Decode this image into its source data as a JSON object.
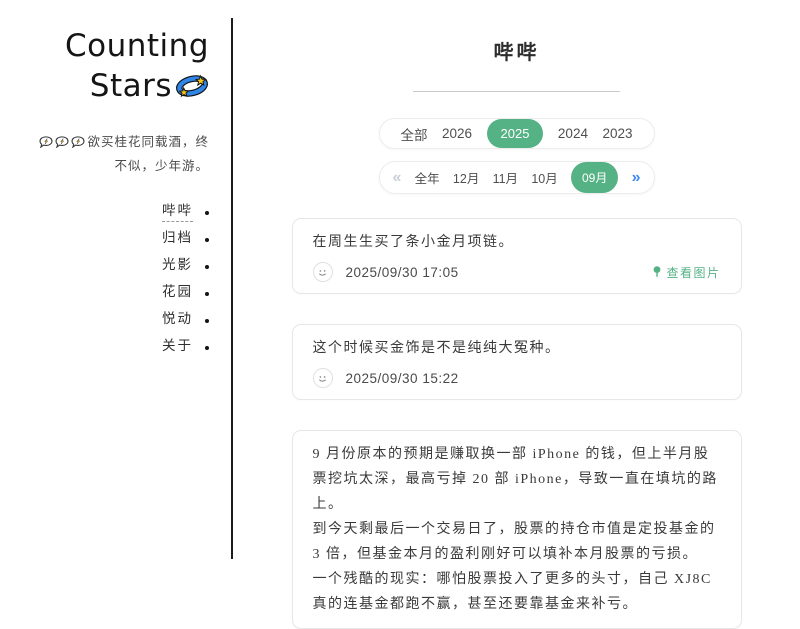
{
  "colors": {
    "accent_green": "#55b285",
    "next_arrow_blue": "#3d8af2",
    "prev_arrow_gray": "#c9ced6"
  },
  "icons": {
    "dizzy_star": "💫",
    "speech_bubble_lightning": "🗯",
    "smiley": "☺",
    "image_pin": "●",
    "prev_chevrons": "«",
    "next_chevrons": "»"
  },
  "sidebar": {
    "title_line1": "Counting",
    "title_line2": "Stars",
    "quote_line1": "欲买桂花同载酒，终",
    "quote_line2": "不似，少年游。",
    "nav": [
      {
        "label": "哔哔",
        "active": true
      },
      {
        "label": "归档",
        "active": false
      },
      {
        "label": "光影",
        "active": false
      },
      {
        "label": "花园",
        "active": false
      },
      {
        "label": "悦动",
        "active": false
      },
      {
        "label": "关于",
        "active": false
      }
    ]
  },
  "main": {
    "page_title": "哔哔",
    "year_filter": {
      "options": [
        "全部",
        "2026",
        "2025",
        "2024",
        "2023"
      ],
      "selected": "2025"
    },
    "month_filter": {
      "options": [
        "全年",
        "12月",
        "11月",
        "10月",
        "09月"
      ],
      "selected": "09月"
    },
    "memos": [
      {
        "paragraphs": [
          "在周生生买了条小金月项链。"
        ],
        "timestamp": "2025/09/30 17:05",
        "view_image_label": "查看图片"
      },
      {
        "paragraphs": [
          "这个时候买金饰是不是纯纯大冤种。"
        ],
        "timestamp": "2025/09/30 15:22"
      },
      {
        "paragraphs": [
          "9 月份原本的预期是赚取换一部 iPhone 的钱，但上半月股票挖坑太深，最高亏掉 20 部 iPhone，导致一直在填坑的路上。",
          "到今天剩最后一个交易日了，股票的持仓市值是定投基金的 3 倍，但基金本月的盈利刚好可以填补本月股票的亏损。",
          "一个残酷的现实：哪怕股票投入了更多的头寸，自己 XJ8C 真的连基金都跑不赢，甚至还要靠基金来补亏。"
        ]
      }
    ]
  }
}
